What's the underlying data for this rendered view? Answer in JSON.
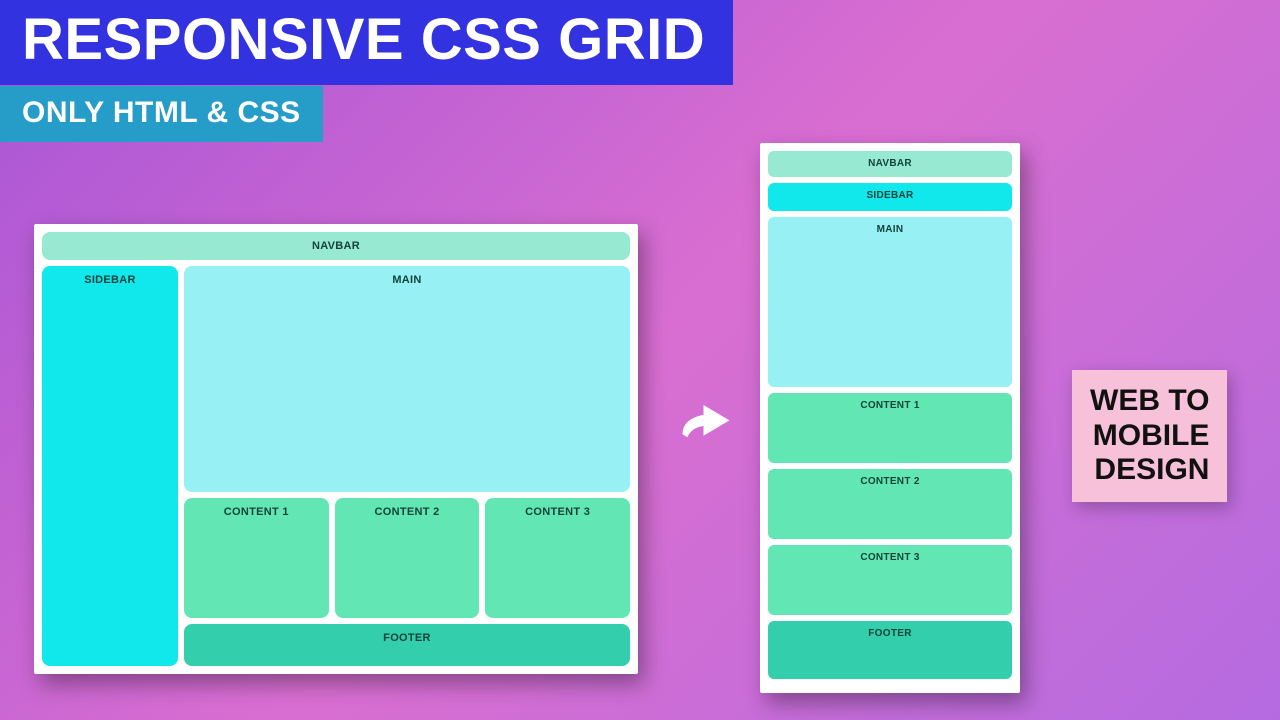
{
  "title": "RESPONSIVE CSS GRID",
  "subtitle": "ONLY HTML & CSS",
  "badge": {
    "l1": "WEB TO",
    "l2": "MOBILE",
    "l3": "DESIGN"
  },
  "regions": {
    "navbar": "NAVBAR",
    "sidebar": "SIDEBAR",
    "main": "MAIN",
    "content1": "CONTENT 1",
    "content2": "CONTENT 2",
    "content3": "CONTENT 3",
    "footer": "FOOTER"
  },
  "colors": {
    "title_bg": "#3332e0",
    "subtitle_bg": "#269cc8",
    "badge_bg": "#f7c2d9",
    "navbar": "#98e9d2",
    "sidebar": "#10e8eb",
    "main": "#97f1f4",
    "content": "#62e7b4",
    "footer": "#33ceab"
  }
}
